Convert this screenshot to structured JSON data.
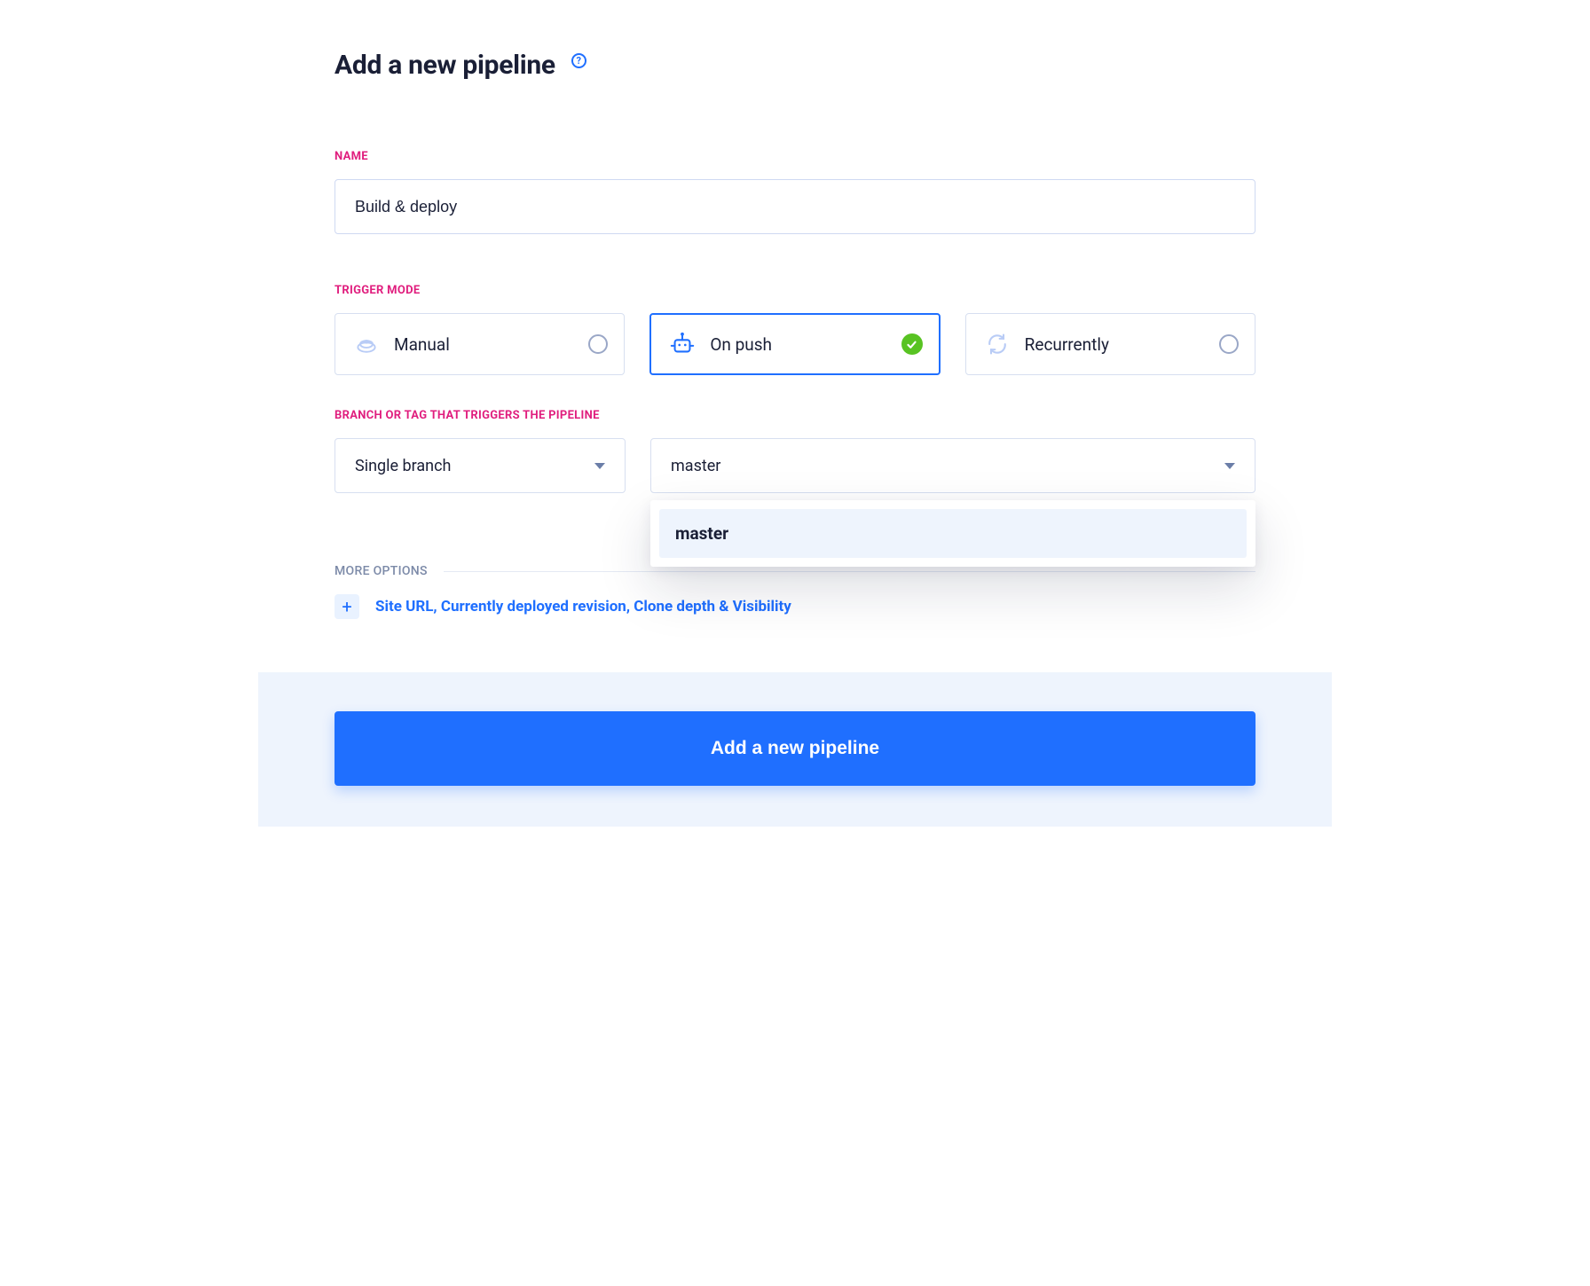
{
  "header": {
    "title": "Add a new pipeline"
  },
  "name_section": {
    "label": "NAME",
    "value": "Build & deploy"
  },
  "trigger_section": {
    "label": "TRIGGER MODE",
    "options": {
      "manual": "Manual",
      "on_push": "On push",
      "recurrently": "Recurrently"
    }
  },
  "branch_section": {
    "label": "BRANCH OR TAG THAT TRIGGERS THE PIPELINE",
    "scope_value": "Single branch",
    "branch_value": "master",
    "dropdown_option": "master"
  },
  "more_options": {
    "label": "MORE OPTIONS",
    "expand_text": "Site URL, Currently deployed revision, Clone depth & Visibility"
  },
  "footer": {
    "submit_label": "Add a new pipeline"
  }
}
